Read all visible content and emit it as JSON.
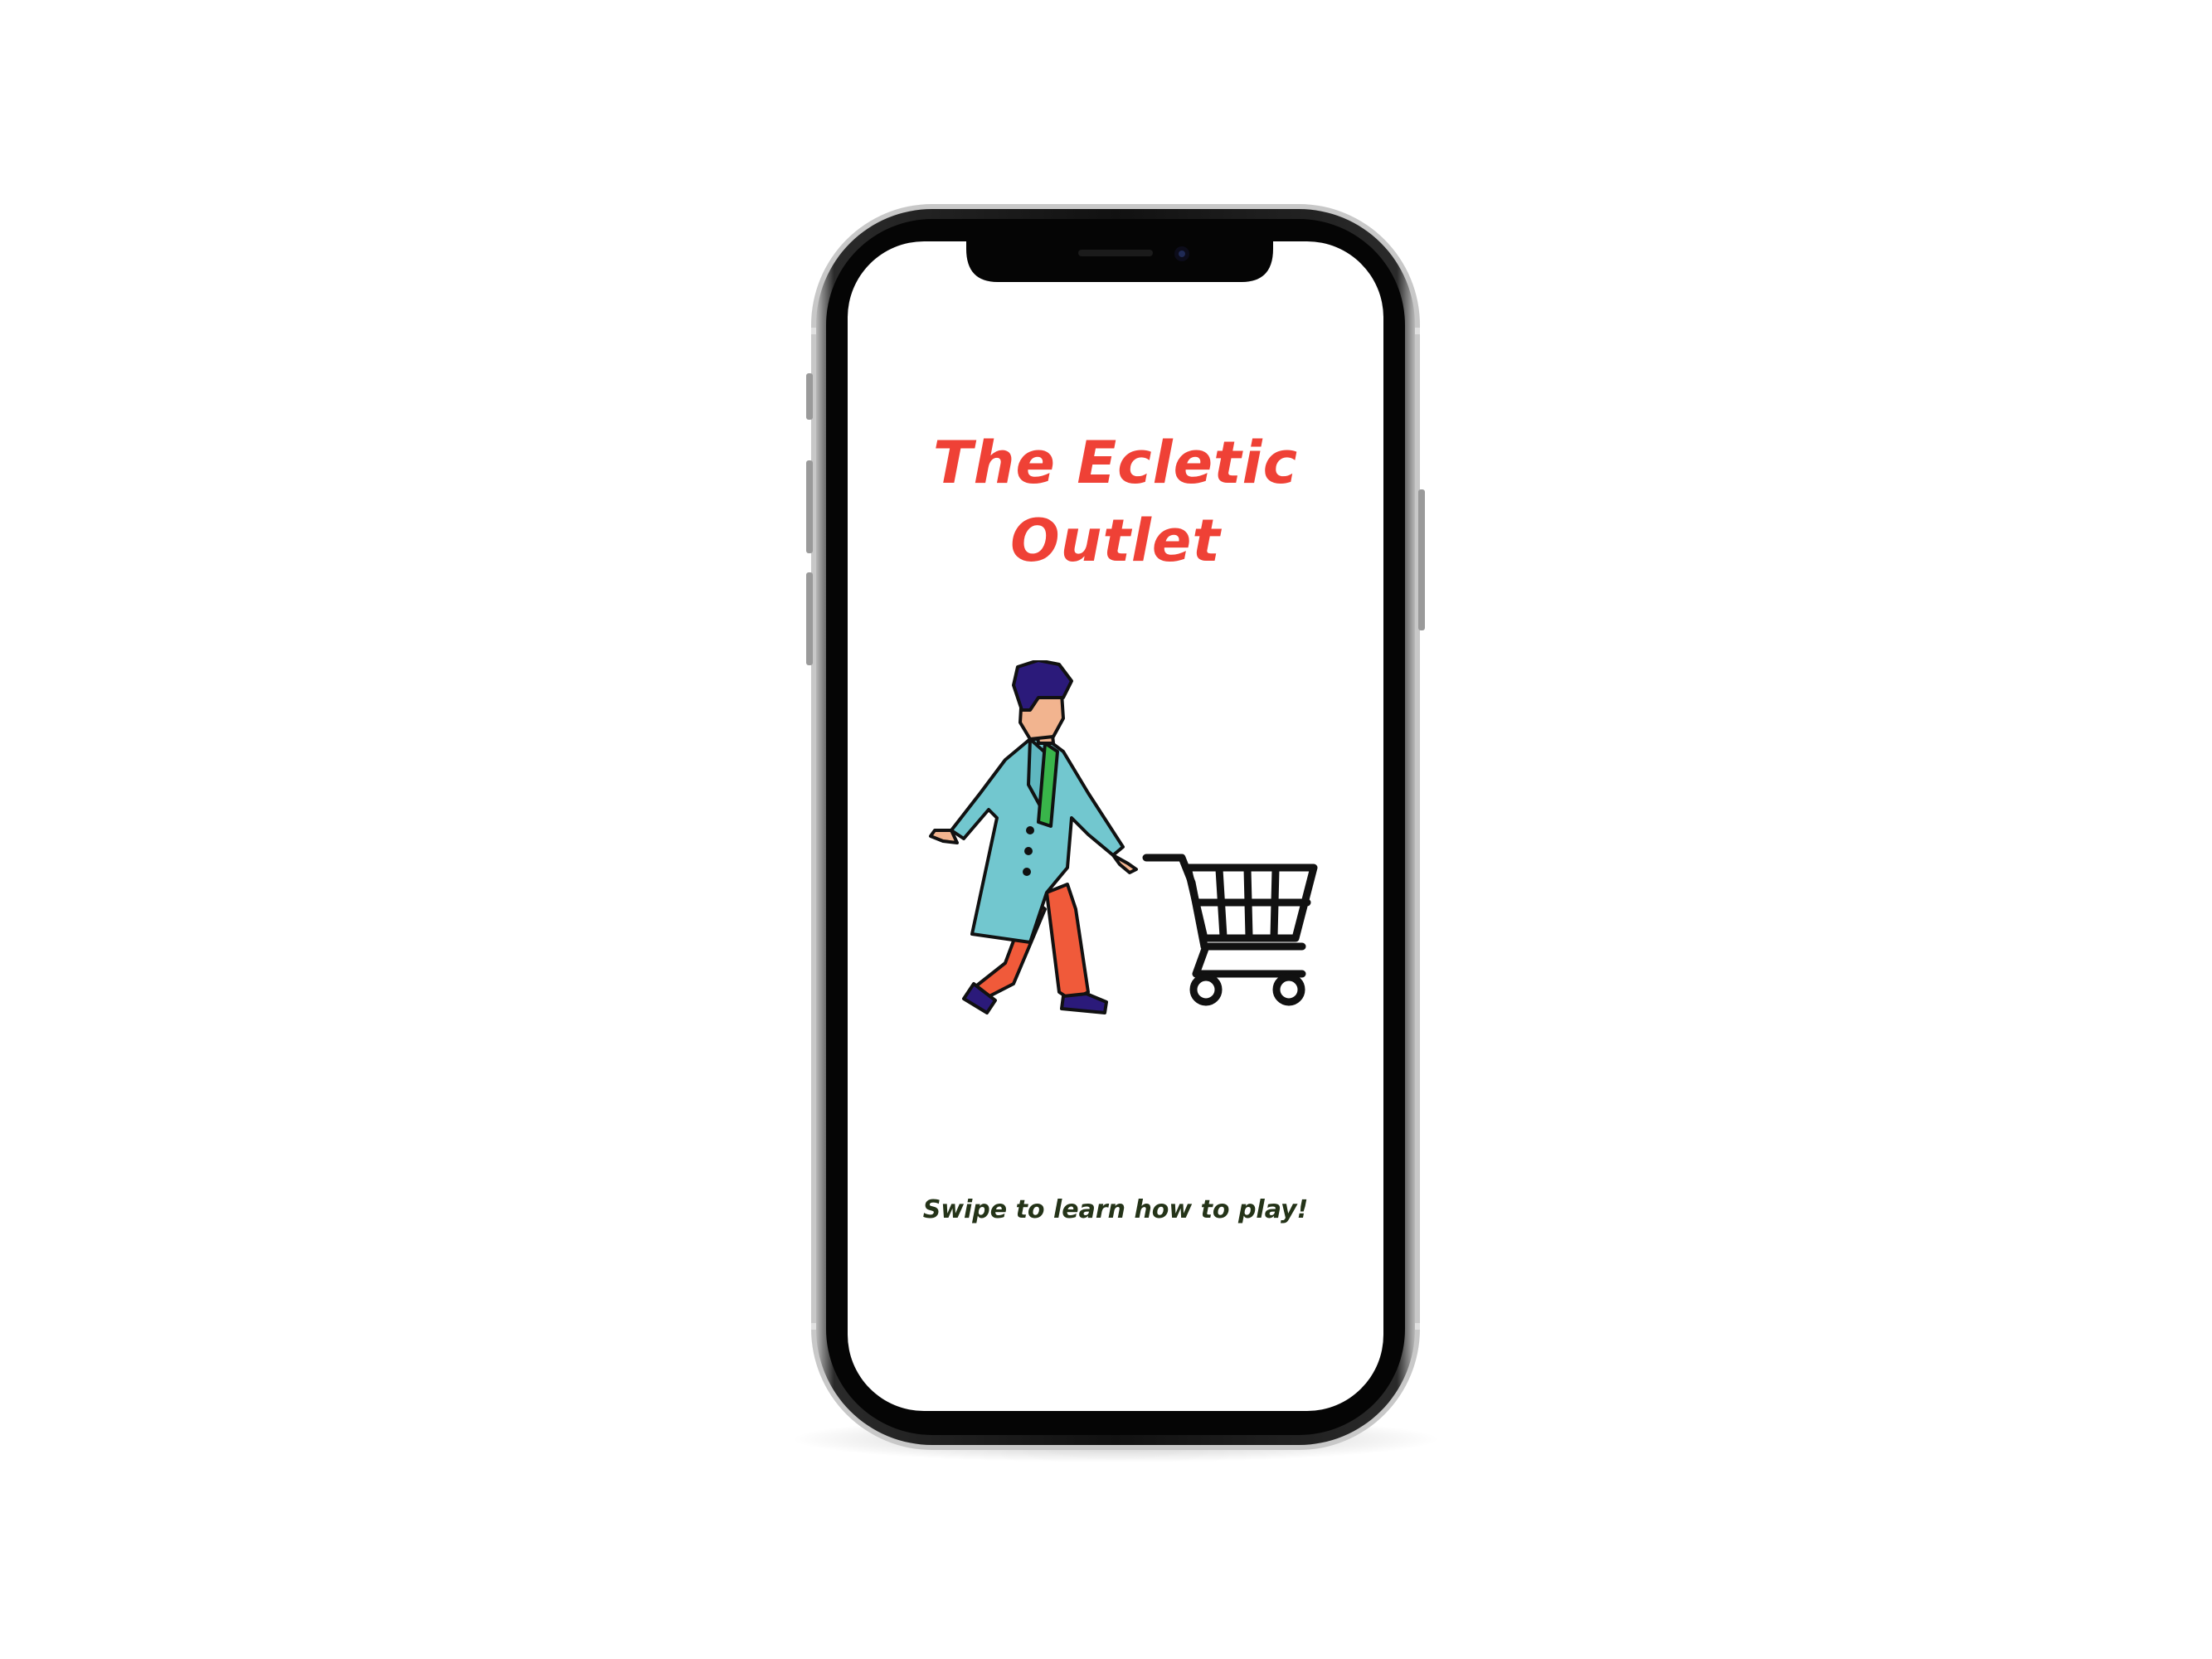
{
  "app": {
    "title_line1": "The Ecletic",
    "title_line2": "Outlet",
    "swipe_hint": "Swipe to learn how to play!"
  },
  "illustration": {
    "subject_icon": "shopper-pushing-cart-illustration",
    "cart_icon": "shopping-cart-icon"
  },
  "colors": {
    "title": "#ef4136",
    "hint": "#243318",
    "coat": "#72c7cf",
    "pants": "#f05a3a",
    "scarf": "#39b54a",
    "hair": "#2b1a7a",
    "skin": "#f2b48f"
  }
}
